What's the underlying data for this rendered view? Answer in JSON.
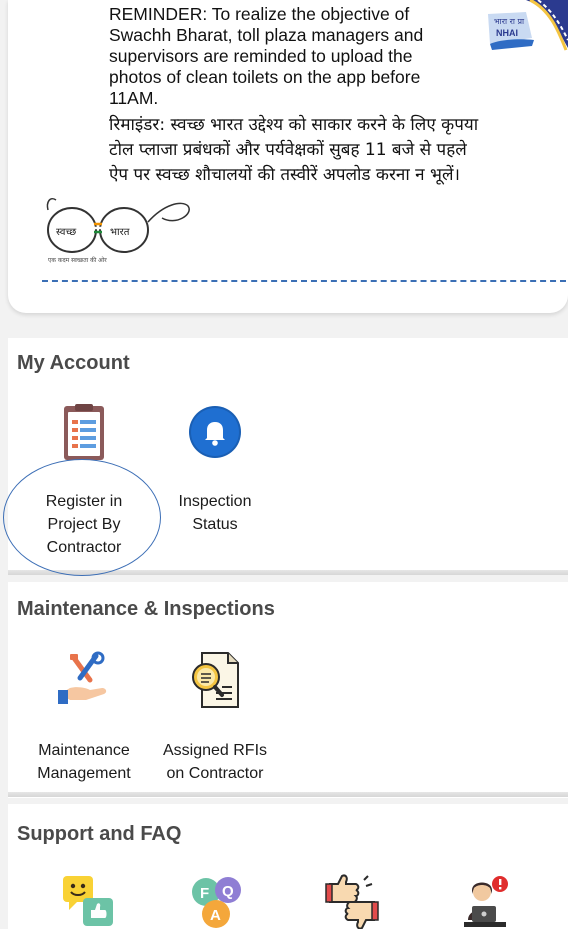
{
  "banner": {
    "reminder_en": "REMINDER: To realize the objective of Swachh Bharat, toll plaza managers and supervisors are reminded to upload the photos of clean toilets on the app before 11AM.",
    "reminder_hi": "रिमाइंडर: स्वच्छ भारत उद्देश्य को साकार करने के लिए कृपया टोल प्लाजा प्रबंधकों और पर्यवेक्षकों सुबह 11 बजे से पहले ऐप पर स्वच्छ शौचालयों की तस्वीरें अपलोड करना न भूलें।",
    "nhai_logo_text": "NHAI",
    "nhai_logo_hindi": "भारा रा प्रा",
    "sb_logo_left": "स्वच्छ",
    "sb_logo_right": "भारत",
    "sb_logo_tagline": "एक कदम स्वच्छता की ओर"
  },
  "sections": {
    "account": {
      "title": "My Account",
      "items": [
        {
          "label_1": "Register in",
          "label_2": "Project By",
          "label_3": "Contractor",
          "icon": "register-document-icon"
        },
        {
          "label_1": "Inspection",
          "label_2": "Status",
          "icon": "bell-notification-icon"
        }
      ]
    },
    "maintenance": {
      "title": "Maintenance & Inspections",
      "items": [
        {
          "label_1": "Maintenance",
          "label_2": "Management",
          "icon": "tools-hand-icon"
        },
        {
          "label_1": "Assigned RFIs",
          "label_2": "on Contractor",
          "icon": "document-search-icon"
        }
      ]
    },
    "support": {
      "title": "Support and FAQ",
      "items": [
        {
          "icon": "feedback-chat-icon"
        },
        {
          "icon": "faq-bubbles-icon"
        },
        {
          "icon": "thumbs-up-down-icon"
        },
        {
          "icon": "support-agent-alert-icon"
        }
      ]
    }
  },
  "colors": {
    "accent_blue": "#1a5fb4",
    "highlight_ring": "#3d6fb6",
    "section_title": "#4a4a4a"
  }
}
